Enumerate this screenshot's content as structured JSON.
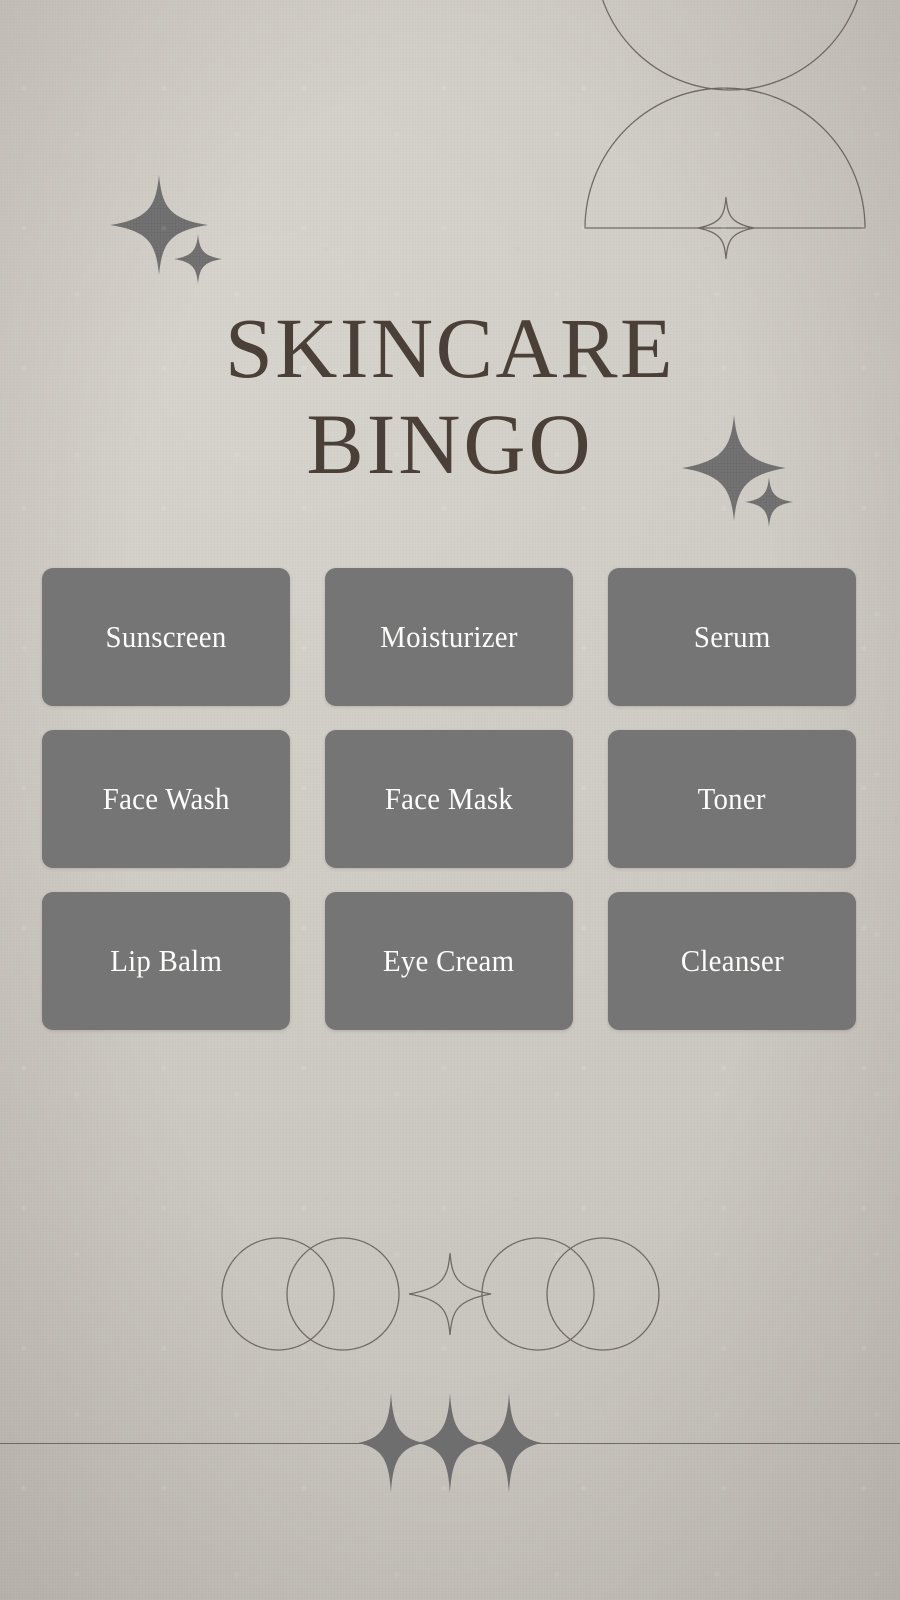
{
  "poster": {
    "title_line_1": "SKINCARE",
    "title_line_2": "BINGO",
    "background_color": "#cbc7c2",
    "title_color": "#4a4038",
    "tile_color": "#757575",
    "tile_text_color": "#ffffff",
    "line_color": "#6f6a64"
  },
  "grid": {
    "rows": 3,
    "columns": 3,
    "cells": [
      {
        "label": "Sunscreen"
      },
      {
        "label": "Moisturizer"
      },
      {
        "label": "Serum"
      },
      {
        "label": "Face Wash"
      },
      {
        "label": "Face Mask"
      },
      {
        "label": "Toner"
      },
      {
        "label": "Lip Balm"
      },
      {
        "label": "Eye Cream"
      },
      {
        "label": "Cleanser"
      }
    ]
  },
  "decorations": {
    "top_left_sparkle_large": "sparkle-icon",
    "top_left_sparkle_small": "sparkle-icon",
    "top_right_circle_outline": "circle-outline",
    "top_right_dome_outline": "dome-outline",
    "top_right_dome_sparkle": "sparkle-outline-icon",
    "title_right_sparkle_large": "sparkle-icon",
    "title_right_sparkle_small": "sparkle-icon",
    "bottom_circles_left": "overlapping-circles-outline",
    "bottom_circles_right": "overlapping-circles-outline",
    "bottom_center_sparkle": "sparkle-outline-icon",
    "bottom_rule_sparkles": "sparkle-icon"
  }
}
